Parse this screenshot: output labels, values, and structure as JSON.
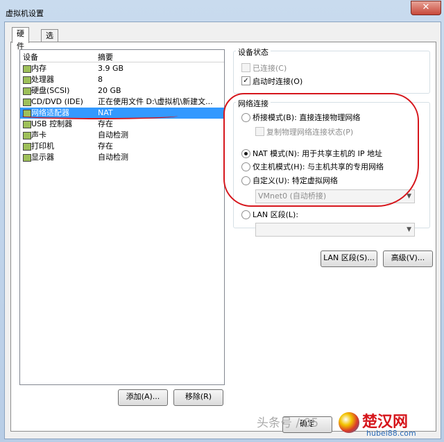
{
  "window": {
    "title": "虚拟机设置",
    "close_label": "✕"
  },
  "tabs": [
    {
      "label": "硬件"
    },
    {
      "label": "选项"
    }
  ],
  "devices": {
    "header_device": "设备",
    "header_summary": "摘要",
    "items": [
      {
        "name": "内存",
        "summary": "3.9 GB",
        "icon": "memory-icon"
      },
      {
        "name": "处理器",
        "summary": "8",
        "icon": "cpu-icon"
      },
      {
        "name": "硬盘(SCSI)",
        "summary": "20 GB",
        "icon": "hard-disk-icon"
      },
      {
        "name": "CD/DVD (IDE)",
        "summary": "正在使用文件 D:\\虚拟机\\新建文...",
        "icon": "cd-dvd-icon"
      },
      {
        "name": "网络适配器",
        "summary": "NAT",
        "icon": "network-adapter-icon",
        "selected": true
      },
      {
        "name": "USB 控制器",
        "summary": "存在",
        "icon": "usb-icon"
      },
      {
        "name": "声卡",
        "summary": "自动检测",
        "icon": "sound-card-icon"
      },
      {
        "name": "打印机",
        "summary": "存在",
        "icon": "printer-icon"
      },
      {
        "name": "显示器",
        "summary": "自动检测",
        "icon": "display-icon"
      }
    ],
    "add_button": "添加(A)...",
    "remove_button": "移除(R)"
  },
  "device_status": {
    "group_label": "设备状态",
    "connected": "已连接(C)",
    "connect_on_power_on": "启动时连接(O)",
    "connected_checked": false,
    "connect_on_power_on_checked": true
  },
  "network": {
    "group_label": "网络连接",
    "bridged": "桥接模式(B): 直接连接物理网络",
    "replicate": "复制物理网络连接状态(P)",
    "nat": "NAT 模式(N): 用于共享主机的 IP 地址",
    "host_only": "仅主机模式(H): 与主机共享的专用网络",
    "custom": "自定义(U): 特定虚拟网络",
    "custom_value": "VMnet0 (自动桥接)",
    "lan_segment": "LAN 区段(L):",
    "lan_segment_value": "",
    "selected": "nat"
  },
  "buttons": {
    "lan_segments": "LAN 区段(S)...",
    "advanced": "高级(V)..."
  },
  "footer": {
    "ok_partial": "确定"
  },
  "watermark": {
    "text": "头条号 / 05"
  },
  "logo": {
    "big": "楚汉网",
    "small": "hubei88.com"
  },
  "colors": {
    "selection": "#3399ff",
    "annotation": "#d6161c"
  }
}
